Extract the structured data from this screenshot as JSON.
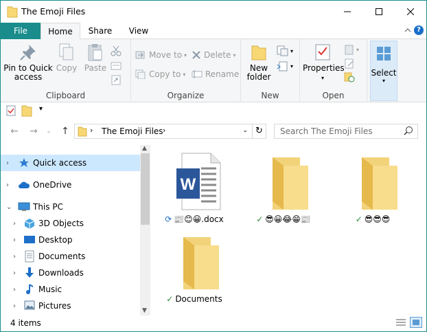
{
  "window": {
    "title": "The Emoji Files",
    "accent": "#1a8c8c"
  },
  "tabs": {
    "file": "File",
    "home": "Home",
    "share": "Share",
    "view": "View",
    "help": "?"
  },
  "ribbon": {
    "clipboard": {
      "label": "Clipboard",
      "pin_label_1": "Pin to Quick",
      "pin_label_2": "access",
      "copy": "Copy",
      "paste": "Paste"
    },
    "organize": {
      "label": "Organize",
      "move_to": "Move to",
      "copy_to": "Copy to",
      "delete": "Delete",
      "rename": "Rename"
    },
    "new": {
      "label": "New",
      "new_folder_1": "New",
      "new_folder_2": "folder"
    },
    "open": {
      "label": "Open",
      "properties": "Properties"
    },
    "select": {
      "label": "Select"
    }
  },
  "address": {
    "path": "The Emoji Files",
    "search_placeholder": "Search The Emoji Files"
  },
  "nav": {
    "items": [
      {
        "label": "Quick access",
        "icon": "star-icon"
      },
      {
        "label": "OneDrive",
        "icon": "cloud-icon"
      },
      {
        "label": "This PC",
        "icon": "computer-icon"
      },
      {
        "label": "3D Objects",
        "icon": "cube-icon"
      },
      {
        "label": "Desktop",
        "icon": "desktop-icon"
      },
      {
        "label": "Documents",
        "icon": "documents-icon"
      },
      {
        "label": "Downloads",
        "icon": "download-icon"
      },
      {
        "label": "Music",
        "icon": "music-icon"
      },
      {
        "label": "Pictures",
        "icon": "pictures-icon"
      }
    ]
  },
  "files": [
    {
      "name": "📰😊😀.docx",
      "type": "word-document",
      "status": "sync"
    },
    {
      "name": "😎😀😂😁📰",
      "type": "folder",
      "status": "synced"
    },
    {
      "name": "😎😎😎",
      "type": "folder",
      "status": "synced"
    },
    {
      "name": "Documents",
      "type": "folder",
      "status": "synced"
    }
  ],
  "status": {
    "count": "4 items"
  }
}
